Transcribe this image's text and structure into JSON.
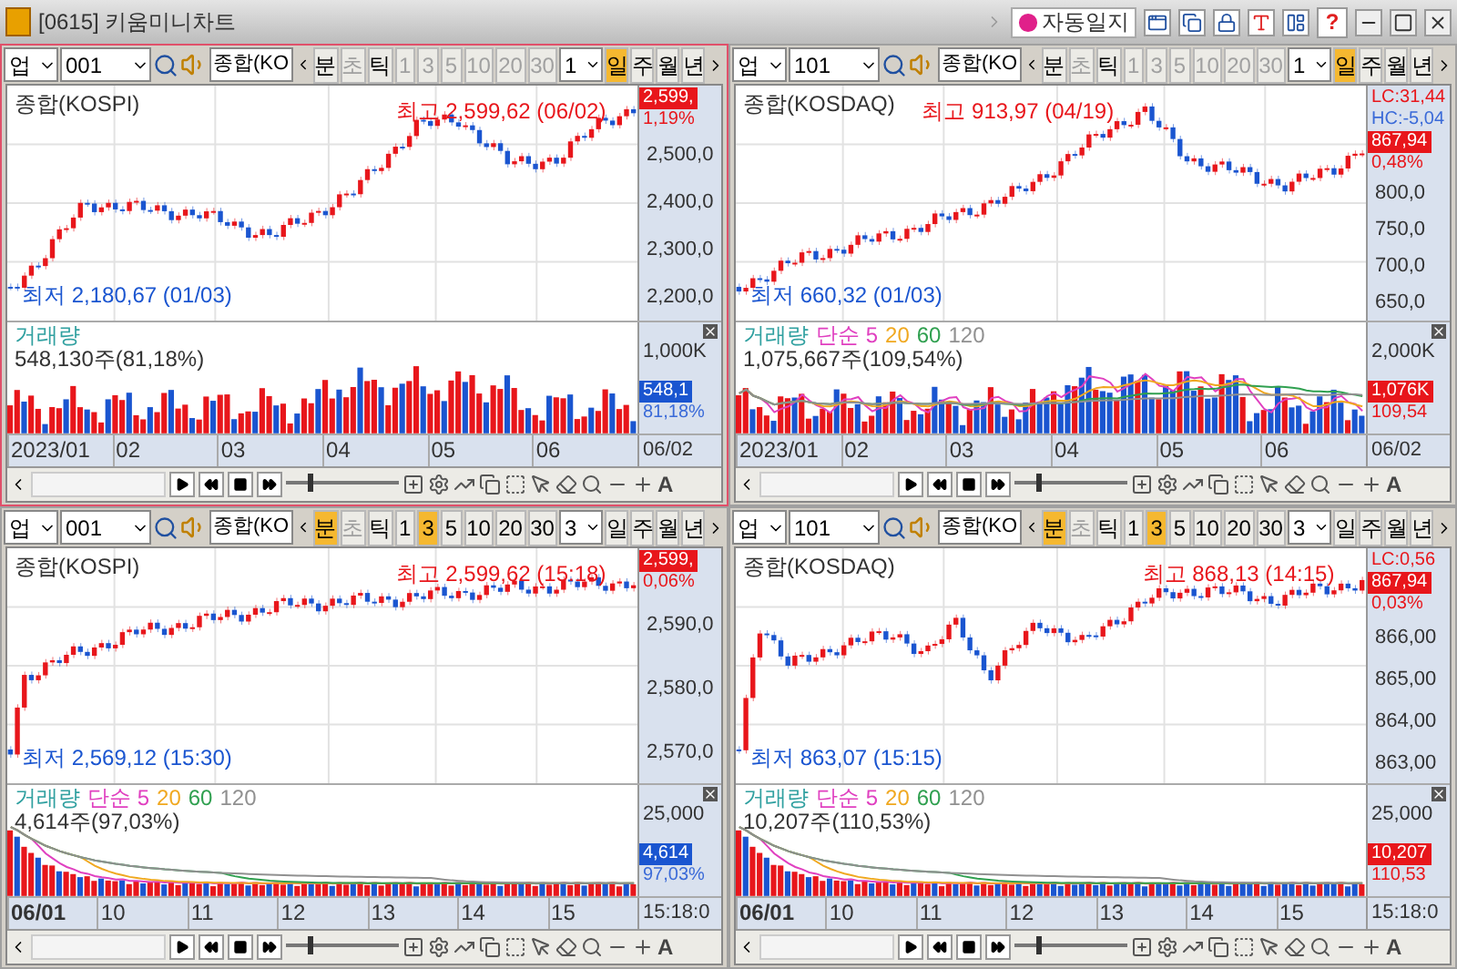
{
  "window": {
    "title": "[0615] 키움미니차트",
    "auto_journal": "자동일지",
    "help": "?"
  },
  "panels": [
    {
      "active": true,
      "market": "업",
      "code": "001",
      "index_name": "종합(KO",
      "units": [
        {
          "label": "분",
          "selected": false,
          "disabled": false
        },
        {
          "label": "초",
          "selected": false,
          "disabled": true
        },
        {
          "label": "틱",
          "selected": false,
          "disabled": false
        }
      ],
      "intervals": [
        {
          "label": "1",
          "selected": false,
          "disabled": true
        },
        {
          "label": "3",
          "selected": false,
          "disabled": true
        },
        {
          "label": "5",
          "selected": false,
          "disabled": true
        },
        {
          "label": "10",
          "selected": false,
          "disabled": true
        },
        {
          "label": "20",
          "selected": false,
          "disabled": true
        },
        {
          "label": "30",
          "selected": false,
          "disabled": true
        }
      ],
      "period": "1",
      "scales": [
        {
          "label": "일",
          "selected": true
        },
        {
          "label": "주",
          "selected": false
        },
        {
          "label": "월",
          "selected": false
        },
        {
          "label": "년",
          "selected": false
        }
      ],
      "price": {
        "title": "종합(KOSPI)",
        "high": "최고 2,599,62 (06/02)",
        "low": "최저 2,180,67 (01/03)",
        "side_labels": [
          {
            "text": "2,599,",
            "kind": "tag-up"
          },
          {
            "text": "1,19%",
            "kind": "up"
          }
        ],
        "yticks": [
          "2,500,0",
          "2,400,0",
          "2,300,0",
          "2,200,0"
        ]
      },
      "volume": {
        "title": "거래량",
        "summary": "548,130주(81,18%)",
        "ytick": "1,000K",
        "side_labels": [
          {
            "text": "548,1",
            "kind": "tag-down"
          },
          {
            "text": "81,18%",
            "kind": "down"
          }
        ]
      },
      "xaxis": {
        "labels": [
          "2023/01",
          "02",
          "03",
          "04",
          "05",
          "06"
        ],
        "last": "06/02"
      },
      "zoom": {
        "level": 0.2
      },
      "font_button": "A"
    },
    {
      "active": false,
      "market": "업",
      "code": "101",
      "index_name": "종합(KO",
      "units": [
        {
          "label": "분",
          "selected": false,
          "disabled": false
        },
        {
          "label": "초",
          "selected": false,
          "disabled": true
        },
        {
          "label": "틱",
          "selected": false,
          "disabled": false
        }
      ],
      "intervals": [
        {
          "label": "1",
          "selected": false,
          "disabled": true
        },
        {
          "label": "3",
          "selected": false,
          "disabled": true
        },
        {
          "label": "5",
          "selected": false,
          "disabled": true
        },
        {
          "label": "10",
          "selected": false,
          "disabled": true
        },
        {
          "label": "20",
          "selected": false,
          "disabled": true
        },
        {
          "label": "30",
          "selected": false,
          "disabled": true
        }
      ],
      "period": "1",
      "scales": [
        {
          "label": "일",
          "selected": true
        },
        {
          "label": "주",
          "selected": false
        },
        {
          "label": "월",
          "selected": false
        },
        {
          "label": "년",
          "selected": false
        }
      ],
      "price": {
        "title": "종합(KOSDAQ)",
        "high": "최고 913,97 (04/19)",
        "low": "최저 660,32 (01/03)",
        "side_labels": [
          {
            "text": "LC:31,44",
            "kind": "up"
          },
          {
            "text": "HC:-5,04",
            "kind": "down"
          },
          {
            "text": "867,94",
            "kind": "tag-up"
          },
          {
            "text": "0,48%",
            "kind": "up"
          }
        ],
        "yticks": [
          "800,0",
          "750,0",
          "700,0",
          "650,0"
        ]
      },
      "volume": {
        "title": "거래량",
        "ma": [
          {
            "label": "단순 5",
            "color": "#e040c0"
          },
          {
            "label": "20",
            "color": "#f0a820"
          },
          {
            "label": "60",
            "color": "#30a050"
          },
          {
            "label": "120",
            "color": "#909090"
          }
        ],
        "summary": "1,075,667주(109,54%)",
        "ytick": "2,000K",
        "side_labels": [
          {
            "text": "1,076K",
            "kind": "tag-up"
          },
          {
            "text": "109,54",
            "kind": "up"
          }
        ]
      },
      "xaxis": {
        "labels": [
          "2023/01",
          "02",
          "03",
          "04",
          "05",
          "06"
        ],
        "last": "06/02"
      },
      "zoom": {
        "level": 0.2
      },
      "font_button": "A"
    },
    {
      "active": false,
      "market": "업",
      "code": "001",
      "index_name": "종합(KO",
      "units": [
        {
          "label": "분",
          "selected": true,
          "disabled": false
        },
        {
          "label": "초",
          "selected": false,
          "disabled": true
        },
        {
          "label": "틱",
          "selected": false,
          "disabled": false
        }
      ],
      "intervals": [
        {
          "label": "1",
          "selected": false,
          "disabled": false
        },
        {
          "label": "3",
          "selected": true,
          "disabled": false
        },
        {
          "label": "5",
          "selected": false,
          "disabled": false
        },
        {
          "label": "10",
          "selected": false,
          "disabled": false
        },
        {
          "label": "20",
          "selected": false,
          "disabled": false
        },
        {
          "label": "30",
          "selected": false,
          "disabled": false
        }
      ],
      "period": "3",
      "scales": [
        {
          "label": "일",
          "selected": false
        },
        {
          "label": "주",
          "selected": false
        },
        {
          "label": "월",
          "selected": false
        },
        {
          "label": "년",
          "selected": false
        }
      ],
      "price": {
        "title": "종합(KOSPI)",
        "high": "최고 2,599,62 (15:18)",
        "low": "최저 2,569,12 (15:30)",
        "side_labels": [
          {
            "text": "2,599,",
            "kind": "tag-up"
          },
          {
            "text": "0,06%",
            "kind": "up"
          }
        ],
        "yticks": [
          "2,590,0",
          "2,580,0",
          "2,570,0"
        ]
      },
      "volume": {
        "title": "거래량",
        "ma": [
          {
            "label": "단순 5",
            "color": "#e040c0"
          },
          {
            "label": "20",
            "color": "#f0a820"
          },
          {
            "label": "60",
            "color": "#30a050"
          },
          {
            "label": "120",
            "color": "#909090"
          }
        ],
        "summary": "4,614주(97,03%)",
        "ytick": "25,000",
        "side_labels": [
          {
            "text": "4,614",
            "kind": "tag-down"
          },
          {
            "text": "97,03%",
            "kind": "down"
          }
        ]
      },
      "xaxis": {
        "labels": [
          "06/01",
          "10",
          "11",
          "12",
          "13",
          "14",
          "15"
        ],
        "last": "15:18:0"
      },
      "zoom": {
        "level": 0.2
      },
      "font_button": "A"
    },
    {
      "active": false,
      "market": "업",
      "code": "101",
      "index_name": "종합(KO",
      "units": [
        {
          "label": "분",
          "selected": true,
          "disabled": false
        },
        {
          "label": "초",
          "selected": false,
          "disabled": true
        },
        {
          "label": "틱",
          "selected": false,
          "disabled": false
        }
      ],
      "intervals": [
        {
          "label": "1",
          "selected": false,
          "disabled": false
        },
        {
          "label": "3",
          "selected": true,
          "disabled": false
        },
        {
          "label": "5",
          "selected": false,
          "disabled": false
        },
        {
          "label": "10",
          "selected": false,
          "disabled": false
        },
        {
          "label": "20",
          "selected": false,
          "disabled": false
        },
        {
          "label": "30",
          "selected": false,
          "disabled": false
        }
      ],
      "period": "3",
      "scales": [
        {
          "label": "일",
          "selected": false
        },
        {
          "label": "주",
          "selected": false
        },
        {
          "label": "월",
          "selected": false
        },
        {
          "label": "년",
          "selected": false
        }
      ],
      "price": {
        "title": "종합(KOSDAQ)",
        "high": "최고 868,13 (14:15)",
        "low": "최저 863,07 (15:15)",
        "side_labels": [
          {
            "text": "LC:0,56",
            "kind": "up"
          },
          {
            "text": "867,94",
            "kind": "tag-up"
          },
          {
            "text": "0,03%",
            "kind": "up"
          }
        ],
        "yticks": [
          "866,00",
          "865,00",
          "864,00",
          "863,00"
        ]
      },
      "volume": {
        "title": "거래량",
        "ma": [
          {
            "label": "단순 5",
            "color": "#e040c0"
          },
          {
            "label": "20",
            "color": "#f0a820"
          },
          {
            "label": "60",
            "color": "#30a050"
          },
          {
            "label": "120",
            "color": "#909090"
          }
        ],
        "summary": "10,207주(110,53%)",
        "ytick": "25,000",
        "side_labels": [
          {
            "text": "10,207",
            "kind": "tag-up"
          },
          {
            "text": "110,53",
            "kind": "up"
          }
        ]
      },
      "xaxis": {
        "labels": [
          "06/01",
          "10",
          "11",
          "12",
          "13",
          "14",
          "15"
        ],
        "last": "15:18:0"
      },
      "zoom": {
        "level": 0.2
      },
      "font_button": "A"
    }
  ]
}
